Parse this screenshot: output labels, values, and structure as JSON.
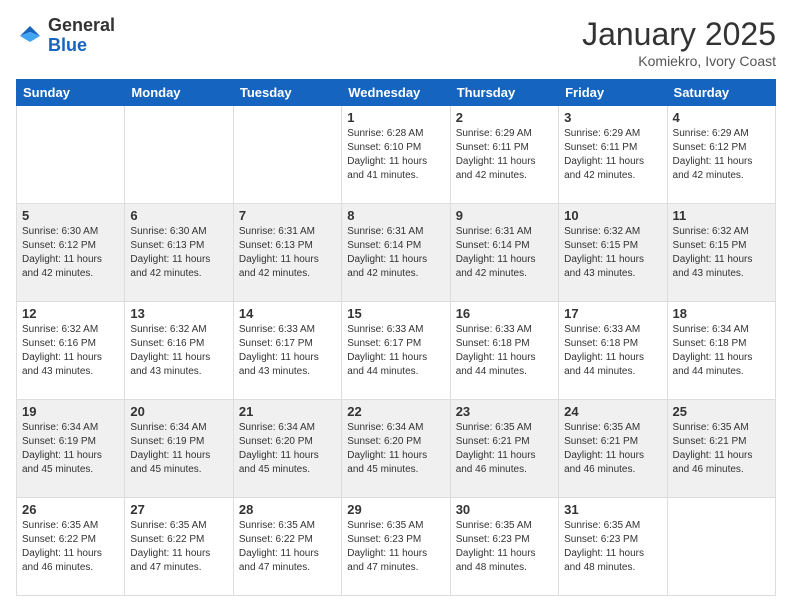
{
  "header": {
    "logo_general": "General",
    "logo_blue": "Blue",
    "month_title": "January 2025",
    "location": "Komiekro, Ivory Coast"
  },
  "days_of_week": [
    "Sunday",
    "Monday",
    "Tuesday",
    "Wednesday",
    "Thursday",
    "Friday",
    "Saturday"
  ],
  "weeks": [
    [
      {
        "day": "",
        "info": ""
      },
      {
        "day": "",
        "info": ""
      },
      {
        "day": "",
        "info": ""
      },
      {
        "day": "1",
        "info": "Sunrise: 6:28 AM\nSunset: 6:10 PM\nDaylight: 11 hours and 41 minutes."
      },
      {
        "day": "2",
        "info": "Sunrise: 6:29 AM\nSunset: 6:11 PM\nDaylight: 11 hours and 42 minutes."
      },
      {
        "day": "3",
        "info": "Sunrise: 6:29 AM\nSunset: 6:11 PM\nDaylight: 11 hours and 42 minutes."
      },
      {
        "day": "4",
        "info": "Sunrise: 6:29 AM\nSunset: 6:12 PM\nDaylight: 11 hours and 42 minutes."
      }
    ],
    [
      {
        "day": "5",
        "info": "Sunrise: 6:30 AM\nSunset: 6:12 PM\nDaylight: 11 hours and 42 minutes."
      },
      {
        "day": "6",
        "info": "Sunrise: 6:30 AM\nSunset: 6:13 PM\nDaylight: 11 hours and 42 minutes."
      },
      {
        "day": "7",
        "info": "Sunrise: 6:31 AM\nSunset: 6:13 PM\nDaylight: 11 hours and 42 minutes."
      },
      {
        "day": "8",
        "info": "Sunrise: 6:31 AM\nSunset: 6:14 PM\nDaylight: 11 hours and 42 minutes."
      },
      {
        "day": "9",
        "info": "Sunrise: 6:31 AM\nSunset: 6:14 PM\nDaylight: 11 hours and 42 minutes."
      },
      {
        "day": "10",
        "info": "Sunrise: 6:32 AM\nSunset: 6:15 PM\nDaylight: 11 hours and 43 minutes."
      },
      {
        "day": "11",
        "info": "Sunrise: 6:32 AM\nSunset: 6:15 PM\nDaylight: 11 hours and 43 minutes."
      }
    ],
    [
      {
        "day": "12",
        "info": "Sunrise: 6:32 AM\nSunset: 6:16 PM\nDaylight: 11 hours and 43 minutes."
      },
      {
        "day": "13",
        "info": "Sunrise: 6:32 AM\nSunset: 6:16 PM\nDaylight: 11 hours and 43 minutes."
      },
      {
        "day": "14",
        "info": "Sunrise: 6:33 AM\nSunset: 6:17 PM\nDaylight: 11 hours and 43 minutes."
      },
      {
        "day": "15",
        "info": "Sunrise: 6:33 AM\nSunset: 6:17 PM\nDaylight: 11 hours and 44 minutes."
      },
      {
        "day": "16",
        "info": "Sunrise: 6:33 AM\nSunset: 6:18 PM\nDaylight: 11 hours and 44 minutes."
      },
      {
        "day": "17",
        "info": "Sunrise: 6:33 AM\nSunset: 6:18 PM\nDaylight: 11 hours and 44 minutes."
      },
      {
        "day": "18",
        "info": "Sunrise: 6:34 AM\nSunset: 6:18 PM\nDaylight: 11 hours and 44 minutes."
      }
    ],
    [
      {
        "day": "19",
        "info": "Sunrise: 6:34 AM\nSunset: 6:19 PM\nDaylight: 11 hours and 45 minutes."
      },
      {
        "day": "20",
        "info": "Sunrise: 6:34 AM\nSunset: 6:19 PM\nDaylight: 11 hours and 45 minutes."
      },
      {
        "day": "21",
        "info": "Sunrise: 6:34 AM\nSunset: 6:20 PM\nDaylight: 11 hours and 45 minutes."
      },
      {
        "day": "22",
        "info": "Sunrise: 6:34 AM\nSunset: 6:20 PM\nDaylight: 11 hours and 45 minutes."
      },
      {
        "day": "23",
        "info": "Sunrise: 6:35 AM\nSunset: 6:21 PM\nDaylight: 11 hours and 46 minutes."
      },
      {
        "day": "24",
        "info": "Sunrise: 6:35 AM\nSunset: 6:21 PM\nDaylight: 11 hours and 46 minutes."
      },
      {
        "day": "25",
        "info": "Sunrise: 6:35 AM\nSunset: 6:21 PM\nDaylight: 11 hours and 46 minutes."
      }
    ],
    [
      {
        "day": "26",
        "info": "Sunrise: 6:35 AM\nSunset: 6:22 PM\nDaylight: 11 hours and 46 minutes."
      },
      {
        "day": "27",
        "info": "Sunrise: 6:35 AM\nSunset: 6:22 PM\nDaylight: 11 hours and 47 minutes."
      },
      {
        "day": "28",
        "info": "Sunrise: 6:35 AM\nSunset: 6:22 PM\nDaylight: 11 hours and 47 minutes."
      },
      {
        "day": "29",
        "info": "Sunrise: 6:35 AM\nSunset: 6:23 PM\nDaylight: 11 hours and 47 minutes."
      },
      {
        "day": "30",
        "info": "Sunrise: 6:35 AM\nSunset: 6:23 PM\nDaylight: 11 hours and 48 minutes."
      },
      {
        "day": "31",
        "info": "Sunrise: 6:35 AM\nSunset: 6:23 PM\nDaylight: 11 hours and 48 minutes."
      },
      {
        "day": "",
        "info": ""
      }
    ]
  ]
}
